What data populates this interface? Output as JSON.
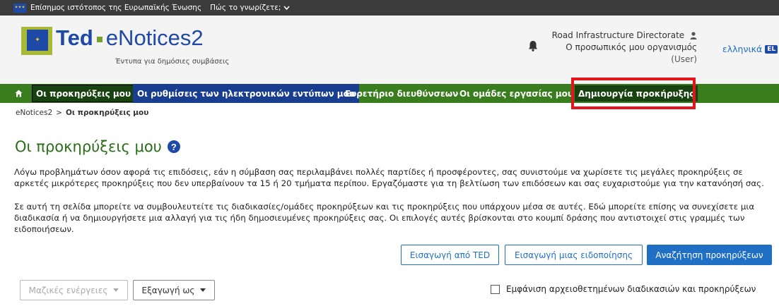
{
  "eu_bar": {
    "text": "Επίσημος ιστότοπος της Ευρωπαϊκής Ένωσης",
    "link": "Πώς το γνωρίζετε;"
  },
  "header": {
    "logo_ted": "Ted",
    "logo_product": "eNotices2",
    "logo_subtitle": "Έντυπα για δημόσιες συμβάσεις",
    "organisation": "Road Infrastructure Directorate",
    "my_organisation": "Ο προσωπικός μου οργανισμός",
    "role": "(User)",
    "language": "ελληνικά",
    "language_code": "EL"
  },
  "nav": {
    "items": [
      {
        "label": "Οι προκηρύξεις μου"
      },
      {
        "label": "Οι ρυθμίσεις των ηλεκτρονικών εντύπων μου"
      },
      {
        "label": "Ευρετήριο διευθύνσεων"
      },
      {
        "label": "Οι ομάδες εργασίας μου"
      },
      {
        "label": "Δημιουργία προκήρυξης"
      }
    ]
  },
  "breadcrumb": {
    "root": "eNotices2",
    "separator": ">",
    "current": "Οι προκηρύξεις μου"
  },
  "main": {
    "title": "Οι προκηρύξεις μου",
    "help": "?",
    "paragraph1": "Λόγω προβλημάτων όσον αφορά τις επιδόσεις, εάν η σύμβαση σας περιλαμβάνει πολλές παρτίδες ή προσφέροντες, σας συνιστούμε να χωρίσετε τις μεγάλες προκηρύξεις σε αρκετές μικρότερες προκηρύξεις που δεν υπερβαίνουν τα 15 ή 20 τμήματα περίπου. Εργαζόμαστε για τη βελτίωση των επιδόσεων και σας ευχαριστούμε για την κατανόησή σας.",
    "paragraph2": "Σε αυτή τη σελίδα μπορείτε να συμβουλευτείτε τις διαδικασίες/ομάδες προκηρύξεων και τις προκηρύξεις που υπάρχουν μέσα σε αυτές. Εδώ μπορείτε επίσης να συνεχίσετε μια διαδικασία ή να δημιουργήσετε μια αλλαγή για τις ήδη δημοσιευμένες προκηρύξεις σας. Οι επιλογές αυτές βρίσκονται στο κουμπί δράσης που αντιστοιχεί στις γραμμές των ειδοποιήσεων.",
    "import_ted": "Εισαγωγή από TED",
    "import_notice": "Εισαγωγή μιας ειδοποίησης",
    "search_notices": "Αναζήτηση προκηρύξεων",
    "bulk_actions": "Μαζικές ενέργειες",
    "export_as": "Εξαγωγή ως",
    "show_archived": "Εμφάνιση αρχειοθετημένων διαδικασιών και προκηρύξεων"
  },
  "colors": {
    "nav_green": "#3a7d1e",
    "nav_blue": "#1a3e8f",
    "title_green": "#2a6e17",
    "accent_blue": "#1f6fc5",
    "highlight_red": "#e3141c"
  }
}
